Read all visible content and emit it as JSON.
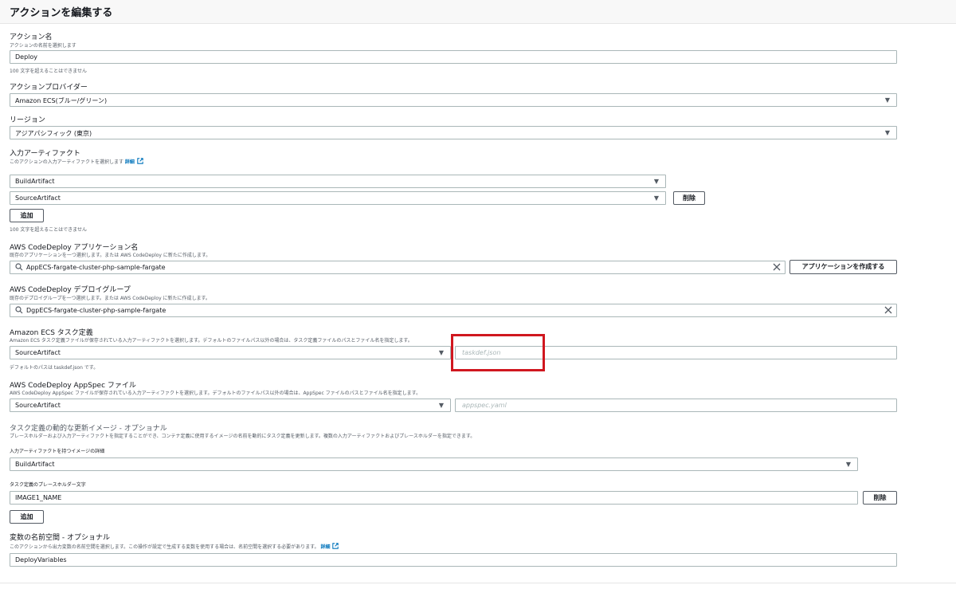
{
  "header": {
    "title": "アクションを編集する"
  },
  "action_name": {
    "label": "アクション名",
    "description": "アクションの名前を選択します",
    "value": "Deploy",
    "hint": "100 文字を超えることはできません"
  },
  "action_provider": {
    "label": "アクションプロバイダー",
    "value": "Amazon ECS(ブルー/グリーン)"
  },
  "region": {
    "label": "リージョン",
    "value": "アジアパシフィック (東京)"
  },
  "input_artifacts": {
    "label": "入力アーティファクト",
    "description": "このアクションの入力アーティファクトを選択します",
    "details_link": "詳細",
    "items": [
      {
        "value": "BuildArtifact"
      },
      {
        "value": "SourceArtifact",
        "remove_label": "削除"
      }
    ],
    "add_label": "追加",
    "hint": "100 文字を超えることはできません"
  },
  "codedeploy_app": {
    "label": "AWS CodeDeploy アプリケーション名",
    "description": "既存のアプリケーションを一つ選択します。または AWS CodeDeploy に新たに作成します。",
    "value": "AppECS-fargate-cluster-php-sample-fargate",
    "create_label": "アプリケーションを作成する"
  },
  "codedeploy_group": {
    "label": "AWS CodeDeploy デプロイグループ",
    "description": "既存のデプロイグループを一つ選択します。または AWS CodeDeploy に新たに作成します。",
    "value": "DgpECS-fargate-cluster-php-sample-fargate"
  },
  "ecs_task_def": {
    "label": "Amazon ECS タスク定義",
    "description": "Amazon ECS タスク定義ファイルが保存されている入力アーティファクトを選択します。デフォルトのファイルパス以外の場合は、タスク定義ファイルのパスとファイル名を指定します。",
    "artifact": "SourceArtifact",
    "path_placeholder": "taskdef.json",
    "hint": "デフォルトのパスは taskdef.json です。"
  },
  "appspec": {
    "label": "AWS CodeDeploy AppSpec ファイル",
    "description": "AWS CodeDeploy AppSpec ファイルが保存されている入力アーティファクトを選択します。デフォルトのファイルパス以外の場合は、AppSpec ファイルのパスとファイル名を指定します。",
    "artifact": "SourceArtifact",
    "path_placeholder": "appspec.yaml"
  },
  "dynamic_images": {
    "label": "タスク定義の動的な更新イメージ - オプショナル",
    "description": "プレースホルダーおよび入力アーティファクトを指定することができ、コンテナ定義に使用するイメージの名前を動的にタスク定義を更新します。複数の入力アーティファクトおよびプレースホルダーを指定できます。",
    "artifact_label": "入力アーティファクトを持つイメージの詳細",
    "artifact_value": "BuildArtifact",
    "placeholder_label": "タスク定義のプレースホルダー文字",
    "placeholder_value": "IMAGE1_NAME",
    "remove_label": "削除",
    "add_label": "追加"
  },
  "namespace": {
    "label": "変数の名前空間 - オプショナル",
    "description": "このアクションから出力変数の名前空間を選択します。この操作が設定で生成する変数を使用する場合は、名前空間を選択する必要があります。",
    "details_link": "詳細",
    "value": "DeployVariables"
  },
  "colors": {
    "highlight": "#d0171f",
    "link": "#0073bb",
    "border": "#aab7b8"
  }
}
